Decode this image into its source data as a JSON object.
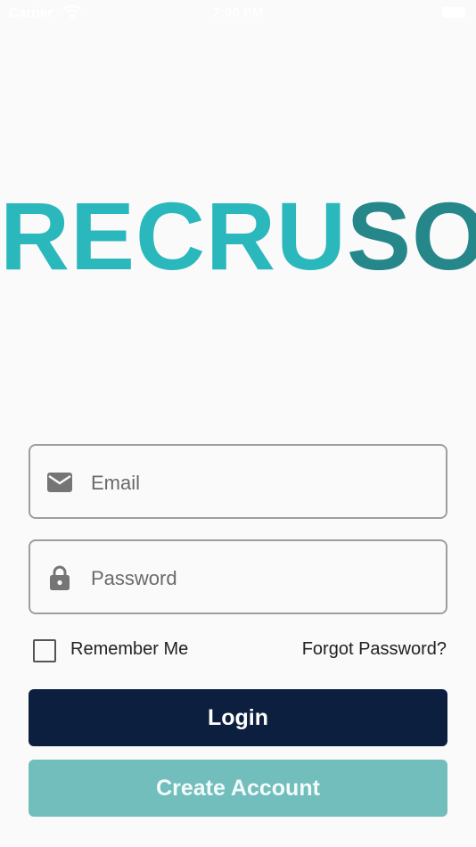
{
  "status_bar": {
    "carrier": "Carrier",
    "time": "7:06 PM"
  },
  "logo": {
    "part_a": "RECRU",
    "part_b": "SO",
    "colors": {
      "part_a": "#2bb8bd",
      "part_b": "#26878b"
    }
  },
  "form": {
    "email": {
      "placeholder": "Email",
      "value": "",
      "icon": "mail-icon"
    },
    "password": {
      "placeholder": "Password",
      "value": "",
      "icon": "lock-icon"
    },
    "remember_label": "Remember Me",
    "remember_checked": false,
    "forgot_label": "Forgot Password?"
  },
  "buttons": {
    "login_label": "Login",
    "create_label": "Create Account",
    "colors": {
      "login": "#0c1f3e",
      "create": "#72bebd"
    }
  }
}
